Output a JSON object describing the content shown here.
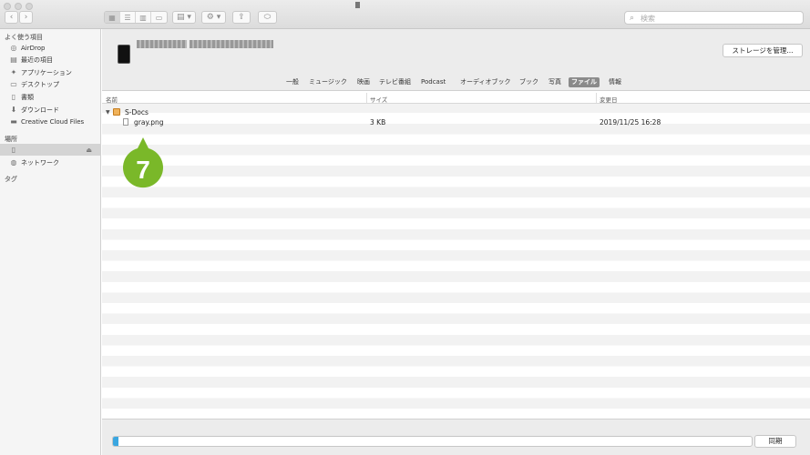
{
  "toolbar": {
    "search_placeholder": "検索",
    "back_glyph": "‹",
    "forward_glyph": "›",
    "view_glyphs": [
      "▦",
      "☰",
      "▥",
      "▭"
    ],
    "group_glyph": "▤ ▾",
    "action_glyph": "⚙ ▾",
    "share_glyph": "⇪",
    "tag_glyph": "⬭"
  },
  "sidebar": {
    "favorites_title": "よく使う項目",
    "favorites": [
      {
        "label": "AirDrop",
        "icon": "airdrop-icon",
        "glyph": "◎"
      },
      {
        "label": "最近の項目",
        "icon": "recents-icon",
        "glyph": "▤"
      },
      {
        "label": "アプリケーション",
        "icon": "applications-icon",
        "glyph": "✦"
      },
      {
        "label": "デスクトップ",
        "icon": "desktop-icon",
        "glyph": "▭"
      },
      {
        "label": "書類",
        "icon": "documents-icon",
        "glyph": "▯"
      },
      {
        "label": "ダウンロード",
        "icon": "downloads-icon",
        "glyph": "⬇"
      },
      {
        "label": "Creative Cloud Files",
        "icon": "folder-icon",
        "glyph": "▬"
      }
    ],
    "locations_title": "場所",
    "locations": [
      {
        "label": "",
        "icon": "iphone-icon",
        "glyph": "▯",
        "selected": true,
        "eject": "⏏"
      },
      {
        "label": "ネットワーク",
        "icon": "network-icon",
        "glyph": "◍"
      }
    ],
    "tags_title": "タグ"
  },
  "device": {
    "manage_storage_label": "ストレージを管理..."
  },
  "tabs": [
    {
      "label": "一般"
    },
    {
      "label": "ミュージック"
    },
    {
      "label": "映画"
    },
    {
      "label": "テレビ番組"
    },
    {
      "label": "Podcast"
    },
    {
      "label": "オーディオブック"
    },
    {
      "label": "ブック"
    },
    {
      "label": "写真"
    },
    {
      "label": "ファイル",
      "active": true
    },
    {
      "label": "情報"
    }
  ],
  "table": {
    "columns": {
      "name": "名前",
      "size": "サイズ",
      "modified": "変更日"
    },
    "rows": [
      {
        "disclosure": "▼",
        "name": "S-Docs",
        "size": "",
        "modified": "",
        "type": "folder"
      },
      {
        "disclosure": "",
        "name": "gray.png",
        "size": "3 KB",
        "modified": "2019/11/25 16:28",
        "type": "file"
      }
    ]
  },
  "callout": {
    "number": "7",
    "color": "#7ab829"
  },
  "storage": {
    "used_fraction": 0.008,
    "fill_color": "#3aa6e0"
  },
  "sync_label": "同期"
}
